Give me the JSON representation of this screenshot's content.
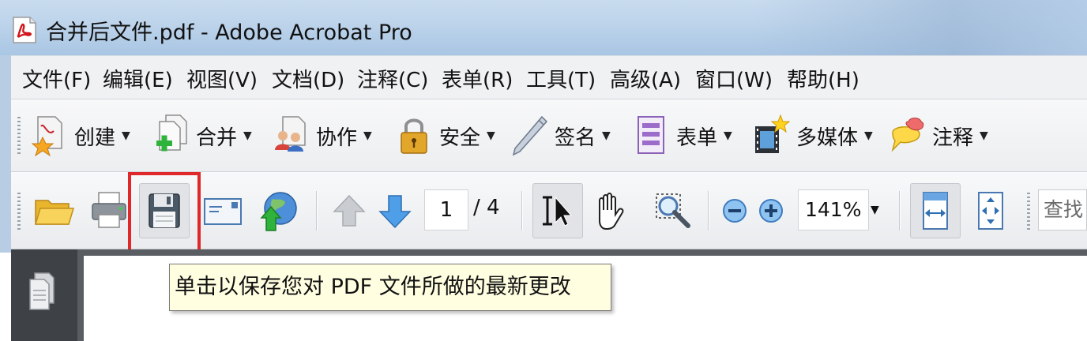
{
  "window": {
    "title": "合并后文件.pdf - Adobe Acrobat Pro",
    "app_icon": "acrobat-pdf-icon"
  },
  "menu": [
    {
      "label": "文件(F)"
    },
    {
      "label": "编辑(E)"
    },
    {
      "label": "视图(V)"
    },
    {
      "label": "文档(D)"
    },
    {
      "label": "注释(C)"
    },
    {
      "label": "表单(R)"
    },
    {
      "label": "工具(T)"
    },
    {
      "label": "高级(A)"
    },
    {
      "label": "窗口(W)"
    },
    {
      "label": "帮助(H)"
    }
  ],
  "tasks": [
    {
      "label": "创建",
      "icon": "create-pdf-icon"
    },
    {
      "label": "合并",
      "icon": "combine-files-icon"
    },
    {
      "label": "协作",
      "icon": "collaborate-icon"
    },
    {
      "label": "安全",
      "icon": "lock-icon"
    },
    {
      "label": "签名",
      "icon": "pen-sign-icon"
    },
    {
      "label": "表单",
      "icon": "form-icon"
    },
    {
      "label": "多媒体",
      "icon": "film-multimedia-icon"
    },
    {
      "label": "注释",
      "icon": "comment-bubble-icon"
    }
  ],
  "toolbar": {
    "open_icon": "folder-open-icon",
    "print_icon": "printer-icon",
    "save_icon": "floppy-disk-icon",
    "email_icon": "email-icon",
    "upload_icon": "globe-upload-icon",
    "prev_icon": "arrow-up-icon",
    "next_icon": "arrow-down-icon",
    "current_page": "1",
    "total_pages": "/ 4",
    "select_icon": "text-select-cursor-icon",
    "hand_icon": "hand-icon",
    "marquee_zoom_icon": "marquee-zoom-icon",
    "zoom_out_icon": "zoom-out-icon",
    "zoom_in_icon": "zoom-in-icon",
    "zoom_value": "141%",
    "fit_width_icon": "fit-width-icon",
    "fit_page_icon": "fit-page-icon",
    "find_label": "查找"
  },
  "tooltip": {
    "text": "单击以保存您对 PDF 文件所做的最新更改"
  },
  "nav_pane": {
    "pages_icon": "pages-panel-icon"
  },
  "colors": {
    "highlight": "#e0272a",
    "tooltip_bg": "#fffee1",
    "title_bar": "#bcd3ea"
  }
}
